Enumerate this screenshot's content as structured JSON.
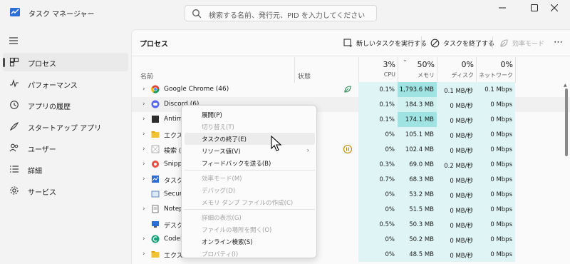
{
  "window": {
    "title": "タスク マネージャー",
    "search_placeholder": "検索する名前、発行元、PID を入力してください"
  },
  "sidebar": {
    "items": [
      {
        "label": "プロセス",
        "icon": "processes-icon",
        "active": true
      },
      {
        "label": "パフォーマンス",
        "icon": "performance-icon"
      },
      {
        "label": "アプリの履歴",
        "icon": "app-history-icon"
      },
      {
        "label": "スタートアップ アプリ",
        "icon": "startup-apps-icon"
      },
      {
        "label": "ユーザー",
        "icon": "users-icon"
      },
      {
        "label": "詳細",
        "icon": "details-icon"
      },
      {
        "label": "サービス",
        "icon": "services-icon"
      }
    ]
  },
  "main": {
    "title": "プロセス",
    "toolbar": {
      "new_task": "新しいタスクを実行する",
      "end_task": "タスクを終了する",
      "efficiency": "効率モード"
    },
    "columns": {
      "name": "名前",
      "status": "状態",
      "cpu": {
        "pct": "3%",
        "label": "CPU"
      },
      "memory": {
        "pct": "50%",
        "label": "メモリ"
      },
      "disk": {
        "pct": "0%",
        "label": "ディスク"
      },
      "network": {
        "pct": "0%",
        "label": "ネットワーク"
      }
    },
    "rows": [
      {
        "name": "Google Chrome (46)",
        "cpu": "0.1%",
        "mem": "1,793.6 MB",
        "disk": "0.1 MB/秒",
        "net": "0.1 Mbps"
      },
      {
        "name": "Discord (6)",
        "cpu": "0.1%",
        "mem": "184.3 MB",
        "disk": "0 MB/秒",
        "net": "0 Mbps"
      },
      {
        "name": "Antima",
        "cpu": "0.1%",
        "mem": "174.1 MB",
        "disk": "0 MB/秒",
        "net": "0 Mbps"
      },
      {
        "name": "エクスプ",
        "cpu": "0%",
        "mem": "105.1 MB",
        "disk": "0 MB/秒",
        "net": "0 Mbps"
      },
      {
        "name": "検索 (5",
        "cpu": "0%",
        "mem": "102.4 MB",
        "disk": "0 MB/秒",
        "net": "0 Mbps"
      },
      {
        "name": "Snippi",
        "cpu": "0.3%",
        "mem": "69.0 MB",
        "disk": "0.2 MB/秒",
        "net": "0 Mbps"
      },
      {
        "name": "タスク マ",
        "cpu": "0.7%",
        "mem": "68.3 MB",
        "disk": "0 MB/秒",
        "net": "0 Mbps"
      },
      {
        "name": "Secure",
        "cpu": "0%",
        "mem": "53.2 MB",
        "disk": "0 MB/秒",
        "net": "0 Mbps"
      },
      {
        "name": "Notep",
        "cpu": "0%",
        "mem": "51.5 MB",
        "disk": "0 MB/秒",
        "net": "0 Mbps"
      },
      {
        "name": "デスクト",
        "cpu": "0.5%",
        "mem": "50.3 MB",
        "disk": "0 MB/秒",
        "net": "0 Mbps"
      },
      {
        "name": "CodeM",
        "cpu": "0%",
        "mem": "50.2 MB",
        "disk": "0 MB/秒",
        "net": "0 Mbps"
      },
      {
        "name": "エクスプ",
        "cpu": "0%",
        "mem": "48.5 MB",
        "disk": "0 MB/秒",
        "net": "0 Mbps"
      }
    ]
  },
  "context_menu": {
    "items": [
      {
        "label": "展開(P)"
      },
      {
        "label": "切り替え(T)",
        "disabled": true
      },
      {
        "label": "タスクの終了(E)",
        "highlighted": true
      },
      {
        "label": "リソース値(V)"
      },
      {
        "label": "フィードバックを送る(B)"
      },
      {
        "label": "効率モード(M)",
        "disabled": true
      },
      {
        "label": "デバッグ(D)",
        "disabled": true
      },
      {
        "label": "メモリ ダンプ ファイルの作成(C)",
        "disabled": true
      },
      {
        "label": "詳細の表示(G)",
        "disabled": true
      },
      {
        "label": "ファイルの場所を開く(O)",
        "disabled": true
      },
      {
        "label": "オンライン検索(S)"
      },
      {
        "label": "プロパティ(I)",
        "disabled": true
      }
    ]
  },
  "colors": {
    "cpu_bg": "#dff5f5",
    "mem_bg_high": "#9fe3e3",
    "mem_bg": "#d2f1f1",
    "accent": "#3a7bd5"
  }
}
